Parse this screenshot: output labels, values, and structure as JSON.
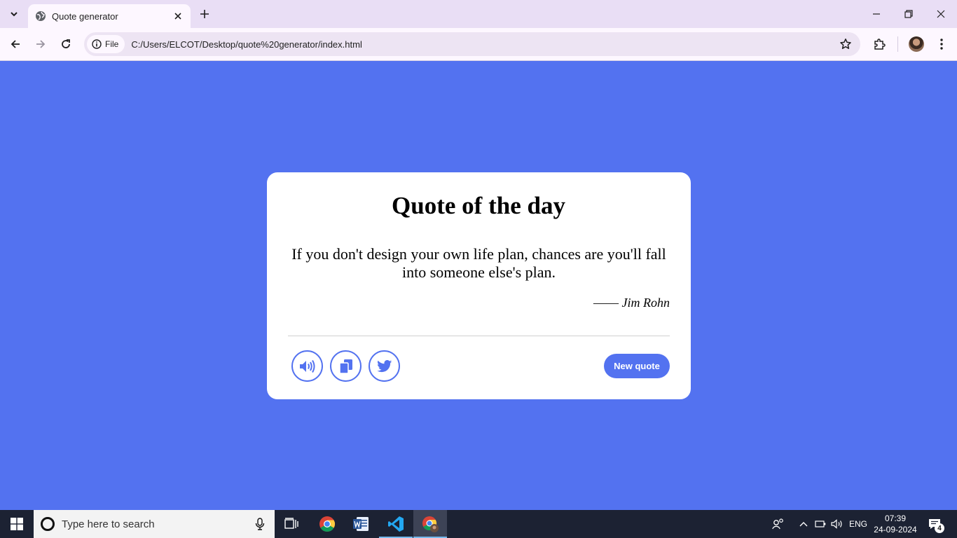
{
  "browser": {
    "tab_title": "Quote generator",
    "site_chip_label": "File",
    "url": "C:/Users/ELCOT/Desktop/quote%20generator/index.html"
  },
  "card": {
    "title": "Quote of the day",
    "quote": "If you don't design your own life plan, chances are you'll fall into someone else's plan.",
    "author_dash": "——",
    "author": "Jim Rohn",
    "buttons": {
      "speak_icon": "volume-icon",
      "copy_icon": "copy-icon",
      "share_icon": "twitter-icon",
      "new_quote_label": "New quote"
    },
    "accent_color": "#5372f0"
  },
  "taskbar": {
    "search_placeholder": "Type here to search",
    "language": "ENG",
    "time": "07:39",
    "date": "24-09-2024",
    "notification_count": "4"
  }
}
